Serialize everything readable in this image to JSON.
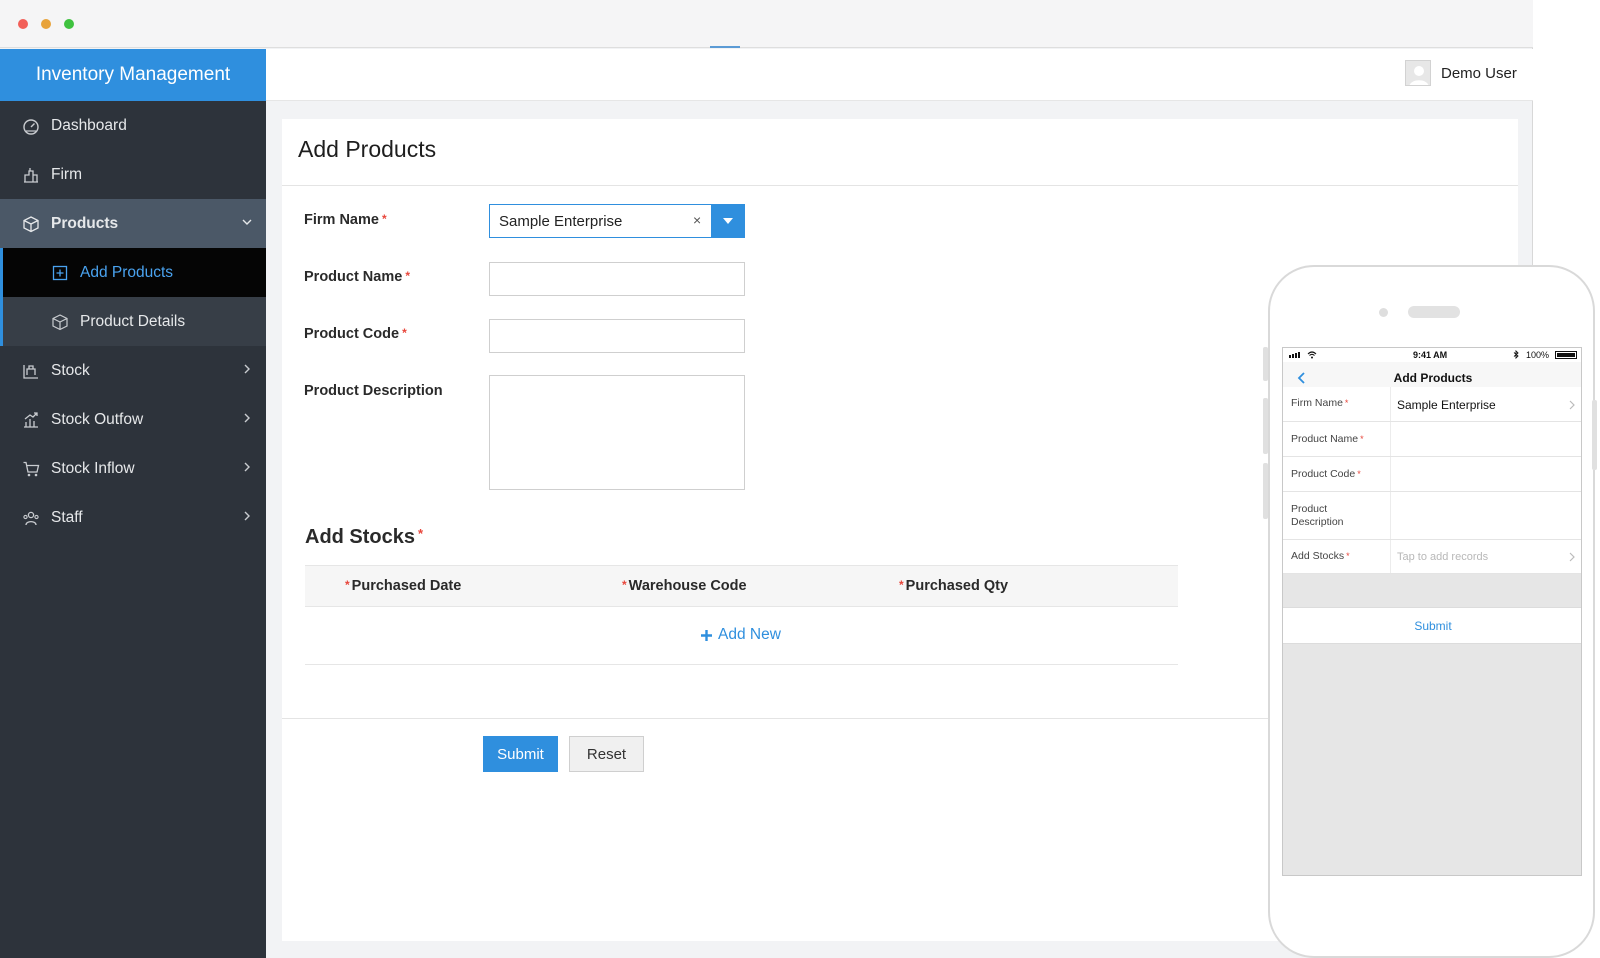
{
  "window": {
    "controls": [
      "close",
      "minimize",
      "maximize"
    ]
  },
  "app": {
    "brand": "Inventory Management",
    "brand_color": "#2f8fde"
  },
  "header": {
    "user_name": "Demo User",
    "avatar_icon": "user-avatar-icon"
  },
  "sidebar": {
    "items": [
      {
        "label": "Dashboard",
        "icon": "dashboard-icon"
      },
      {
        "label": "Firm",
        "icon": "firm-icon"
      },
      {
        "label": "Products",
        "icon": "box-icon",
        "expanded": true
      },
      {
        "label": "Add Products",
        "icon": "add-box-icon",
        "selected": true
      },
      {
        "label": "Product Details",
        "icon": "box-detail-icon"
      },
      {
        "label": "Stock",
        "icon": "stock-icon"
      },
      {
        "label": "Stock Outfow",
        "icon": "outflow-icon"
      },
      {
        "label": "Stock Inflow",
        "icon": "cart-icon"
      },
      {
        "label": "Staff",
        "icon": "staff-icon"
      }
    ]
  },
  "form": {
    "title": "Add Products",
    "fields": {
      "firm_name": {
        "label": "Firm Name",
        "value": "Sample Enterprise",
        "clear": "×"
      },
      "product_name": {
        "label": "Product Name",
        "value": ""
      },
      "product_code": {
        "label": "Product Code",
        "value": ""
      },
      "product_description": {
        "label": "Product Description",
        "value": ""
      }
    },
    "required_mark": "*",
    "stocks": {
      "title": "Add Stocks",
      "columns": [
        "Purchased Date",
        "Warehouse Code",
        "Purchased Qty"
      ],
      "add_new": "Add New"
    },
    "buttons": {
      "submit": "Submit",
      "reset": "Reset"
    }
  },
  "phone": {
    "status": {
      "time": "9:41 AM",
      "battery": "100%"
    },
    "title": "Add Products",
    "rows": [
      {
        "label": "Firm Name",
        "value": "Sample Enterprise"
      },
      {
        "label": "Product Name",
        "value": ""
      },
      {
        "label": "Product Code",
        "value": ""
      },
      {
        "label": "Product Description",
        "value": ""
      },
      {
        "label": "Add Stocks",
        "placeholder": "Tap to add records"
      }
    ],
    "submit": "Submit"
  }
}
